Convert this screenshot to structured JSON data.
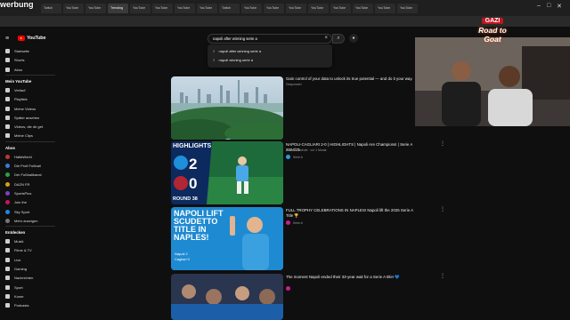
{
  "watermark": "werbung",
  "browser": {
    "tabs": [
      {
        "label": "Twitch"
      },
      {
        "label": "YouTube"
      },
      {
        "label": "YouTube"
      },
      {
        "label": "Trending"
      },
      {
        "label": "YouTube"
      },
      {
        "label": "YouTube"
      },
      {
        "label": "YouTube"
      },
      {
        "label": "YouTube"
      },
      {
        "label": "Twitch"
      },
      {
        "label": "YouTube"
      },
      {
        "label": "YouTube"
      },
      {
        "label": "YouTube"
      },
      {
        "label": "YouTube"
      },
      {
        "label": "YouTube"
      },
      {
        "label": "YouTube"
      },
      {
        "label": "YouTube"
      },
      {
        "label": "YouTube"
      }
    ]
  },
  "youtube": {
    "logo_text": "YouTube",
    "search": {
      "query": "napoli after winning serie a",
      "suggestions": [
        "napoli after winning serie a",
        "napoli winning serie a"
      ]
    },
    "sidebar": {
      "top": [
        {
          "label": "Startseite"
        },
        {
          "label": "Shorts"
        },
        {
          "label": "Abos"
        }
      ],
      "me_title": "Mein YouTube",
      "me": [
        {
          "label": "Verlauf"
        },
        {
          "label": "Playlists"
        },
        {
          "label": "Meine Videos"
        },
        {
          "label": "Später ansehen"
        },
        {
          "label": "Videos, die dir gef."
        },
        {
          "label": "Meine Clips"
        }
      ],
      "abos_title": "Abos",
      "abos": [
        {
          "label": "HalfaWorld",
          "color": "#b73a3a"
        },
        {
          "label": "Die Profi Fußball",
          "color": "#3a7bd5"
        },
        {
          "label": "Der Fußballkanal",
          "color": "#2f9e44"
        },
        {
          "label": "DAZN FR",
          "color": "#d4a017"
        },
        {
          "label": "SportsPlus",
          "color": "#7b3fbf"
        },
        {
          "label": "Join the",
          "color": "#c2185b"
        },
        {
          "label": "Sky Sport",
          "color": "#1e88e5"
        },
        {
          "label": "Mehr anzeigen",
          "color": "#777777"
        }
      ],
      "explore_title": "Entdecken",
      "explore": [
        {
          "label": "Musik"
        },
        {
          "label": "Filme & TV"
        },
        {
          "label": "Live"
        },
        {
          "label": "Gaming"
        },
        {
          "label": "Nachrichten"
        },
        {
          "label": "Sport"
        },
        {
          "label": "Kurse"
        },
        {
          "label": "Podcasts"
        }
      ]
    },
    "results": [
      {
        "title": "Gain control of your data to unlock its true potential — and do it your way.",
        "channel": "Gesponsert",
        "meta": "",
        "desc": "",
        "thumb": "city",
        "avatar": "#ffffff"
      },
      {
        "title": "NAPOLI-CAGLIARI 2-0 | HIGHLIGHTS | Napoli Are Champions! | Serie A 2024/25",
        "channel": "Serie A",
        "meta": "Serie A · Aufrufe · vor 1 Monat",
        "desc": "",
        "thumb": "highlights",
        "avatar": "#1ea0e3",
        "thumb_text": {
          "banner": "HIGHLIGHTS",
          "home": "2",
          "away": "0",
          "round": "ROUND 38"
        }
      },
      {
        "title": "FULL TROPHY CELEBRATIONS IN NAPLES! Napoli lift the 2025 Serie A Title 🏆",
        "channel": "Serie A",
        "meta": "",
        "desc": "",
        "thumb": "trophy",
        "avatar": "#c81e96",
        "thumb_text": {
          "headline": "NAPOLI LIFT SCUDETTO TITLE IN NAPLES!",
          "score_home": "Napoli 2",
          "score_away": "Cagliari 0"
        }
      },
      {
        "title": "The moment Napoli ended their 33-year wait for a Serie A title! 💙",
        "channel": "",
        "meta": "",
        "desc": "",
        "thumb": "crowd",
        "avatar": "#c81e96"
      }
    ]
  },
  "overlay": {
    "brand_top": "GAZI",
    "brand_sub": "Road to Goat"
  }
}
